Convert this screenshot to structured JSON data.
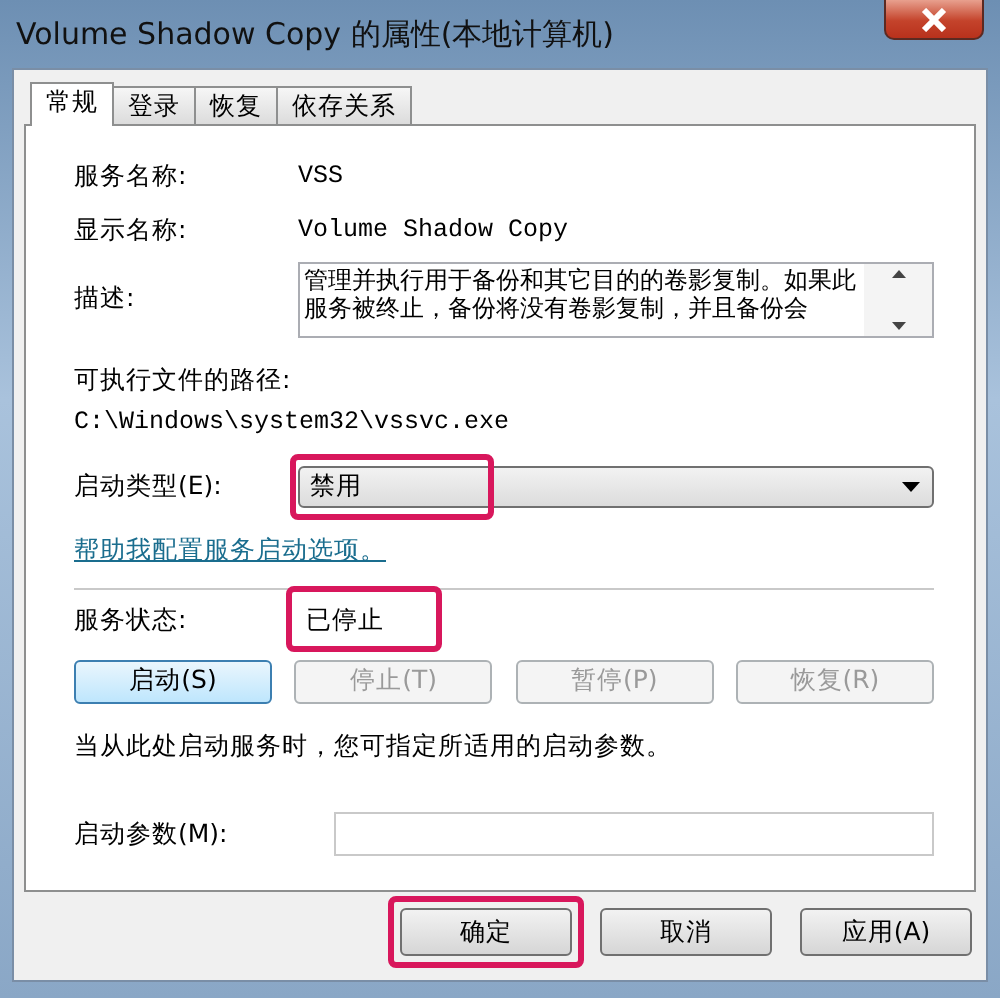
{
  "window": {
    "title": "Volume Shadow Copy 的属性(本地计算机)"
  },
  "tabs": [
    {
      "label": "常规",
      "selected": true
    },
    {
      "label": "登录",
      "selected": false
    },
    {
      "label": "恢复",
      "selected": false
    },
    {
      "label": "依存关系",
      "selected": false
    }
  ],
  "general": {
    "service_name": {
      "label": "服务名称:",
      "value": "VSS"
    },
    "display_name": {
      "label": "显示名称:",
      "value": "Volume Shadow Copy"
    },
    "description": {
      "label": "描述:",
      "value": "管理并执行用于备份和其它目的的卷影复制。如果此服务被终止，备份将没有卷影复制，并且备份会"
    },
    "executable_path": {
      "label": "可执行文件的路径:",
      "value": "C:\\Windows\\system32\\vssvc.exe"
    },
    "startup_type": {
      "label": "启动类型(E):",
      "value": "禁用",
      "highlighted": true
    },
    "help_link": "帮助我配置服务启动选项。",
    "service_status": {
      "label": "服务状态:",
      "value": "已停止",
      "highlighted": true
    },
    "control_buttons": [
      {
        "label": "启动(S)",
        "disabled": false
      },
      {
        "label": "停止(T)",
        "disabled": true
      },
      {
        "label": "暂停(P)",
        "disabled": true
      },
      {
        "label": "恢复(R)",
        "disabled": true
      }
    ],
    "start_hint": "当从此处启动服务时，您可指定所适用的启动参数。",
    "start_parameters": {
      "label": "启动参数(M):"
    }
  },
  "buttons": [
    {
      "label": "确定",
      "highlighted": true
    },
    {
      "label": "取消",
      "highlighted": false
    },
    {
      "label": "应用(A)",
      "highlighted": false
    }
  ]
}
